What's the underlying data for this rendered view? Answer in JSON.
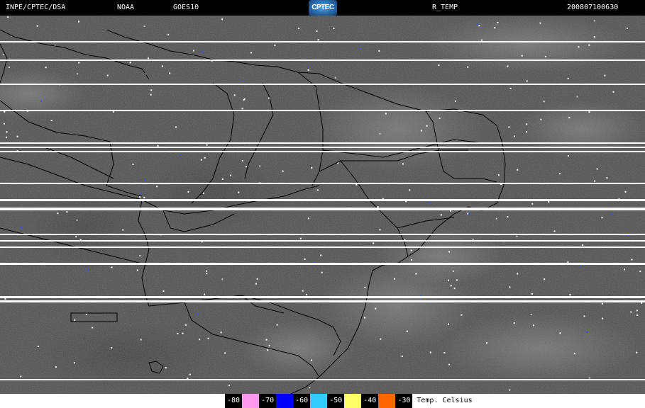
{
  "header": {
    "source": "INPE/CPTEC/DSA",
    "agency": "NOAA",
    "satellite": "GOES10",
    "logo_text": "CPTEC",
    "product": "R_TEMP",
    "timestamp": "200807100630"
  },
  "image": {
    "type": "infrared satellite image",
    "region_shown": "northeastern Brazil with state boundaries and coastline",
    "colors": {
      "background": "#4a4a4a",
      "borders": "#000000",
      "scan_lines": "#ffffff"
    }
  },
  "legend": {
    "items": [
      {
        "label": "-80",
        "color": "#ff99ee"
      },
      {
        "label": "-70",
        "color": "#0000ff"
      },
      {
        "label": "-60",
        "color": "#33ccff"
      },
      {
        "label": "-50",
        "color": "#ffff66"
      },
      {
        "label": "-40",
        "color": "#ff6600"
      },
      {
        "label": "-30",
        "color": null
      }
    ],
    "unit": "Temp. Celsius"
  }
}
